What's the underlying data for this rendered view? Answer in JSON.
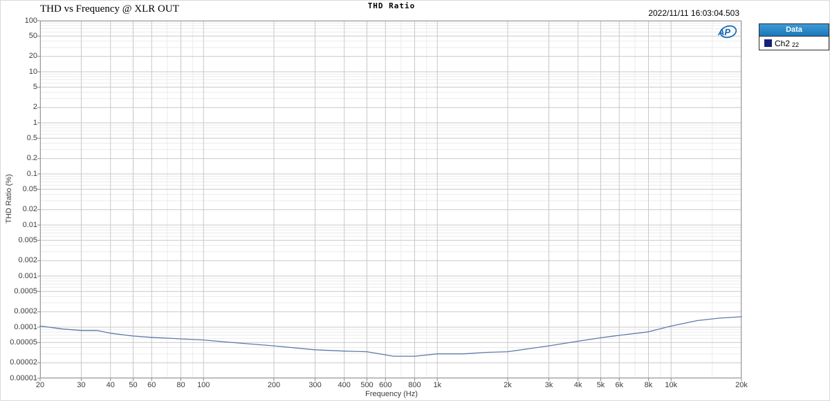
{
  "header": {
    "left_title": "THD vs Frequency @ XLR OUT",
    "center_title": "THD Ratio",
    "timestamp": "2022/11/11 16:03:04.503"
  },
  "logo": {
    "text": "AP"
  },
  "legend": {
    "header": "Data",
    "entries": [
      {
        "label": "Ch2",
        "number": "22",
        "swatch_color": "#15217b"
      }
    ]
  },
  "colors": {
    "legend_header_blue": "#1c7fc2",
    "series_line": "#5d79a5",
    "series_swatch_navy": "#15217b",
    "grid_major": "#c8c8c8",
    "grid_minor": "#ebebeb",
    "plot_border": "#999999",
    "logo_blue": "#1567b3"
  },
  "axes": {
    "y": {
      "title": "THD Ratio (%)",
      "ticks": [
        {
          "label": "100",
          "value": 100
        },
        {
          "label": "50",
          "value": 50
        },
        {
          "label": "20",
          "value": 20
        },
        {
          "label": "10",
          "value": 10
        },
        {
          "label": "5",
          "value": 5
        },
        {
          "label": "2",
          "value": 2
        },
        {
          "label": "1",
          "value": 1
        },
        {
          "label": "0.5",
          "value": 0.5
        },
        {
          "label": "0.2",
          "value": 0.2
        },
        {
          "label": "0.1",
          "value": 0.1
        },
        {
          "label": "0.05",
          "value": 0.05
        },
        {
          "label": "0.02",
          "value": 0.02
        },
        {
          "label": "0.01",
          "value": 0.01
        },
        {
          "label": "0.005",
          "value": 0.005
        },
        {
          "label": "0.002",
          "value": 0.002
        },
        {
          "label": "0.001",
          "value": 0.001
        },
        {
          "label": "0.0005",
          "value": 0.0005
        },
        {
          "label": "0.0002",
          "value": 0.0002
        },
        {
          "label": "0.0001",
          "value": 0.0001
        },
        {
          "label": "0.00005",
          "value": 5e-05
        },
        {
          "label": "0.00002",
          "value": 2e-05
        },
        {
          "label": "0.00001",
          "value": 1e-05
        }
      ],
      "minor_mantissas": [
        3,
        4,
        6,
        7,
        8,
        9
      ]
    },
    "x": {
      "title": "Frequency (Hz)",
      "ticks": [
        {
          "label": "20",
          "value": 20
        },
        {
          "label": "30",
          "value": 30
        },
        {
          "label": "40",
          "value": 40
        },
        {
          "label": "50",
          "value": 50
        },
        {
          "label": "60",
          "value": 60
        },
        {
          "label": "80",
          "value": 80
        },
        {
          "label": "100",
          "value": 100
        },
        {
          "label": "200",
          "value": 200
        },
        {
          "label": "300",
          "value": 300
        },
        {
          "label": "400",
          "value": 400
        },
        {
          "label": "500",
          "value": 500
        },
        {
          "label": "600",
          "value": 600
        },
        {
          "label": "800",
          "value": 800
        },
        {
          "label": "1k",
          "value": 1000
        },
        {
          "label": "2k",
          "value": 2000
        },
        {
          "label": "3k",
          "value": 3000
        },
        {
          "label": "4k",
          "value": 4000
        },
        {
          "label": "5k",
          "value": 5000
        },
        {
          "label": "6k",
          "value": 6000
        },
        {
          "label": "8k",
          "value": 8000
        },
        {
          "label": "10k",
          "value": 10000
        },
        {
          "label": "20k",
          "value": 20000
        }
      ],
      "minor_values": [
        70,
        90,
        700,
        900,
        7000,
        9000,
        15000
      ]
    }
  },
  "chart_data": {
    "type": "line",
    "title": "THD Ratio",
    "subtitle": "THD vs Frequency @ XLR OUT",
    "xlabel": "Frequency (Hz)",
    "ylabel": "THD Ratio (%)",
    "x_scale": "log",
    "y_scale": "log",
    "xlim": [
      20,
      20000
    ],
    "ylim": [
      1e-05,
      100
    ],
    "grid": true,
    "legend_position": "top-right-outside",
    "series": [
      {
        "name": "Ch2 22",
        "color": "#5d79a5",
        "x": [
          20,
          25,
          30,
          35,
          40,
          50,
          60,
          80,
          100,
          140,
          200,
          300,
          400,
          500,
          650,
          800,
          1000,
          1300,
          1600,
          2000,
          3000,
          4000,
          5000,
          6000,
          8000,
          10000,
          13000,
          16000,
          20000
        ],
        "values": [
          0.000105,
          9.2e-05,
          8.6e-05,
          8.6e-05,
          7.6e-05,
          6.7e-05,
          6.3e-05,
          5.9e-05,
          5.6e-05,
          4.9e-05,
          4.3e-05,
          3.6e-05,
          3.4e-05,
          3.3e-05,
          2.7e-05,
          2.7e-05,
          3e-05,
          3e-05,
          3.2e-05,
          3.3e-05,
          4.3e-05,
          5.3e-05,
          6.2e-05,
          6.9e-05,
          8.1e-05,
          0.000105,
          0.000135,
          0.00015,
          0.00016
        ]
      }
    ]
  }
}
